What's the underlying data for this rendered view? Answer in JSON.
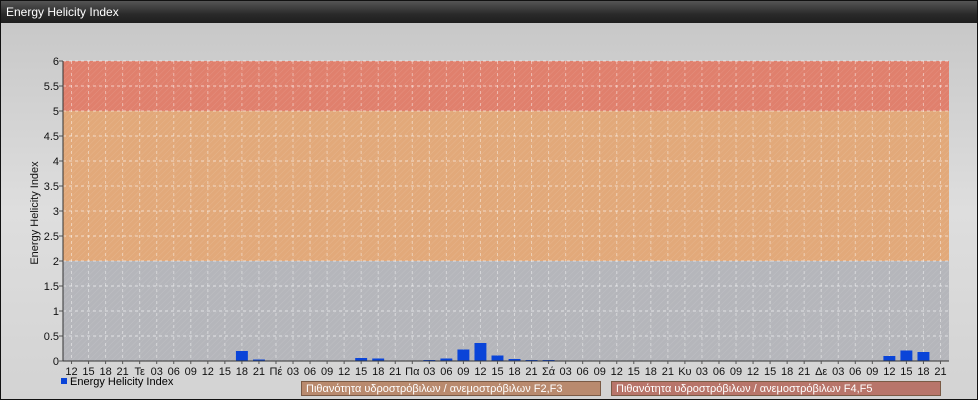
{
  "window": {
    "title": "Energy Helicity Index"
  },
  "colors": {
    "band_high": "#e0806d",
    "band_mid": "#e2a97a",
    "band_low": "#b5b6bb",
    "bar": "#0a44d8",
    "legend_f2f3": "#b98a6e",
    "legend_f4f5": "#b8756a"
  },
  "chart_data": {
    "type": "bar",
    "title": "",
    "ylabel": "Energy Helicity Index",
    "xlabel": "",
    "ylim": [
      0,
      6
    ],
    "yticks": [
      "0",
      "0.5",
      "1",
      "1.5",
      "2",
      "2.5",
      "3",
      "3.5",
      "4",
      "4.5",
      "5",
      "5.5",
      "6"
    ],
    "grid": true,
    "categories": [
      "12",
      "15",
      "18",
      "21",
      "Τε",
      "03",
      "06",
      "09",
      "12",
      "15",
      "18",
      "21",
      "Πέ",
      "03",
      "06",
      "09",
      "12",
      "15",
      "18",
      "21",
      "Πα",
      "03",
      "06",
      "09",
      "12",
      "15",
      "18",
      "21",
      "Σά",
      "03",
      "06",
      "09",
      "12",
      "15",
      "18",
      "21",
      "Κυ",
      "03",
      "06",
      "09",
      "12",
      "15",
      "18",
      "21",
      "Δε",
      "03",
      "06",
      "09",
      "12",
      "15",
      "18",
      "21"
    ],
    "series": [
      {
        "name": "Energy Helicity Index",
        "values": [
          0.01,
          0.01,
          0.01,
          0.01,
          0.01,
          0.01,
          0.01,
          0.01,
          0.01,
          0.01,
          0.2,
          0.03,
          0.01,
          0.01,
          0.01,
          0.01,
          0.01,
          0.06,
          0.05,
          0.01,
          0.01,
          0.02,
          0.05,
          0.23,
          0.36,
          0.11,
          0.04,
          0.02,
          0.02,
          0.01,
          0.01,
          0.01,
          0.01,
          0.01,
          0.01,
          0.01,
          0.01,
          0.01,
          0.01,
          0.01,
          0.01,
          0.01,
          0.01,
          0.01,
          0.01,
          0.01,
          0.01,
          0.01,
          0.1,
          0.21,
          0.18,
          0.01
        ]
      }
    ],
    "bands": [
      {
        "from": 2,
        "to": 5,
        "label": "Πιθανότητα υδροστρόβιλων / ανεμοστρόβιλων F2,F3"
      },
      {
        "from": 5,
        "to": 6,
        "label": "Πιθανότητα υδροστρόβιλων / ανεμοστρόβιλων F4,F5"
      }
    ],
    "legend_position": "bottom"
  }
}
